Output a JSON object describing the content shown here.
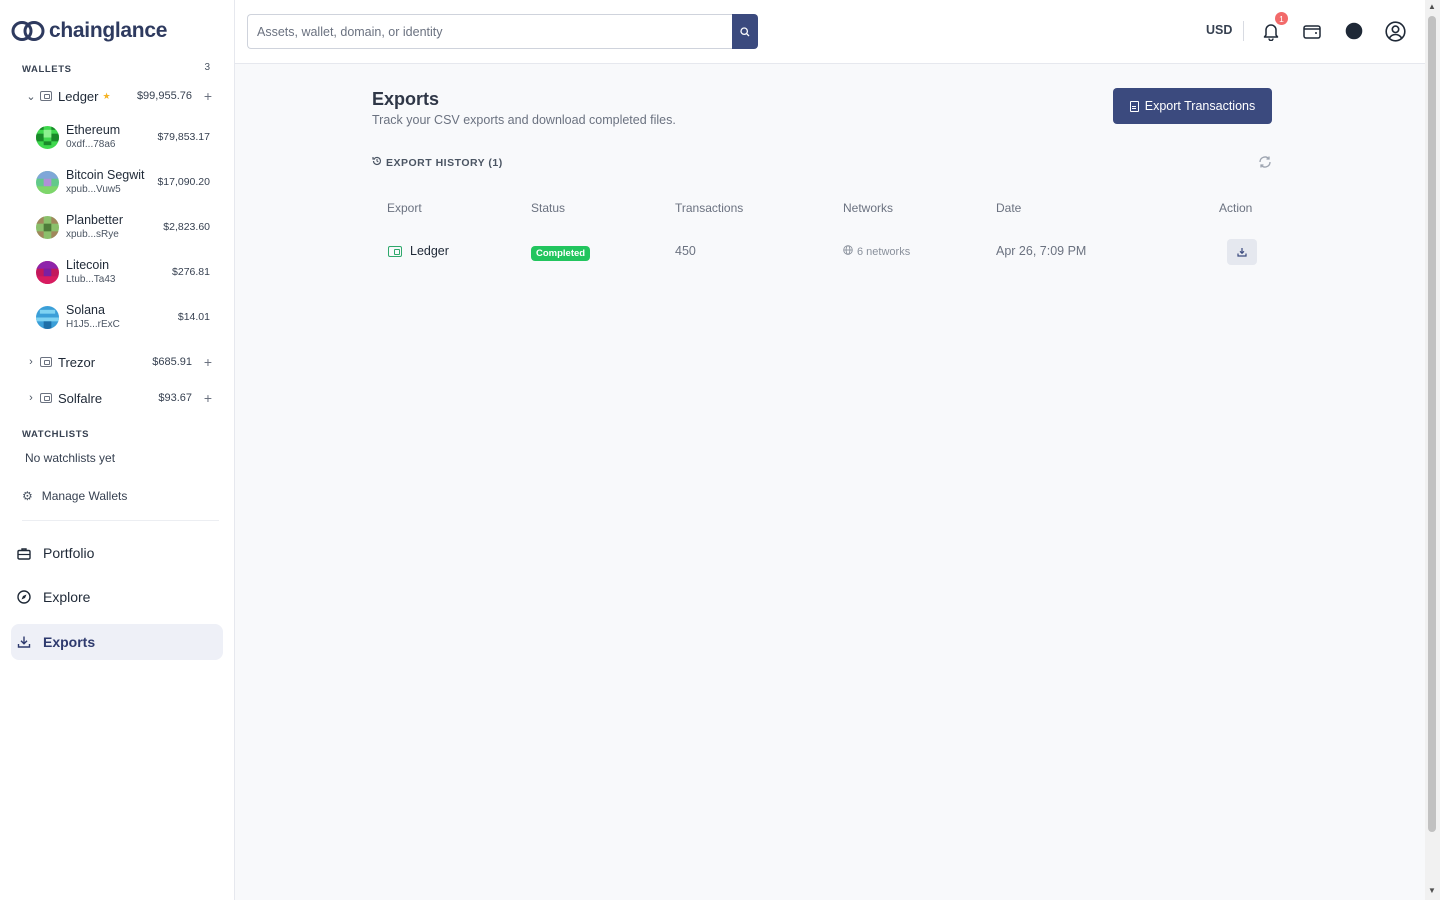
{
  "app": {
    "name": "chainglance"
  },
  "sidebar": {
    "wallets_label": "WALLETS",
    "wallets_count": "3",
    "wallets": [
      {
        "name": "Ledger",
        "value": "$99,955.76",
        "starred": true,
        "expanded": true,
        "assets": [
          {
            "name": "Ethereum",
            "address": "0xdf...78a6",
            "value": "$79,853.17"
          },
          {
            "name": "Bitcoin Segwit",
            "address": "xpub...Vuw5",
            "value": "$17,090.20"
          },
          {
            "name": "Planbetter",
            "address": "xpub...sRye",
            "value": "$2,823.60"
          },
          {
            "name": "Litecoin",
            "address": "Ltub...Ta43",
            "value": "$276.81"
          },
          {
            "name": "Solana",
            "address": "H1J5...rExC",
            "value": "$14.01"
          }
        ]
      },
      {
        "name": "Trezor",
        "value": "$685.91",
        "expanded": false
      },
      {
        "name": "Solfalre",
        "value": "$93.67",
        "expanded": false
      }
    ],
    "watchlists_label": "WATCHLISTS",
    "no_watchlists": "No watchlists yet",
    "manage_wallets": "Manage Wallets",
    "nav": [
      {
        "label": "Portfolio",
        "icon": "briefcase-icon"
      },
      {
        "label": "Explore",
        "icon": "compass-icon"
      },
      {
        "label": "Exports",
        "icon": "download-icon",
        "active": true
      }
    ]
  },
  "topbar": {
    "search_placeholder": "Assets, wallet, domain, or identity",
    "currency": "USD",
    "notification_count": "1"
  },
  "main": {
    "title": "Exports",
    "subtitle": "Track your CSV exports and download completed files.",
    "export_button": "Export Transactions",
    "history_label": "EXPORT HISTORY (1)",
    "columns": [
      "Export",
      "Status",
      "Transactions",
      "Networks",
      "Date",
      "Action"
    ],
    "rows": [
      {
        "export": "Ledger",
        "status": "Completed",
        "transactions": "450",
        "networks": "6 networks",
        "date": "Apr 26, 7:09 PM"
      }
    ]
  },
  "colors": {
    "accent": "#3b4a7e",
    "success": "#22c55e",
    "badge": "#f26a6a",
    "star": "#f5b324"
  }
}
